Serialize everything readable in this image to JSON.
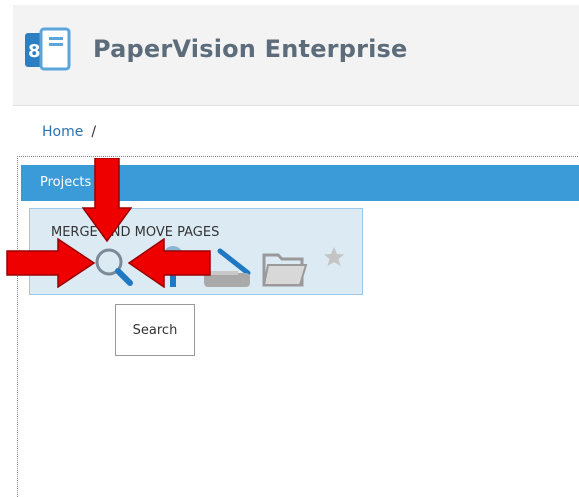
{
  "header": {
    "title": "PaperVision Enterprise",
    "logo_icon": "papervision-logo-icon"
  },
  "breadcrumb": {
    "home": "Home",
    "separator": "/"
  },
  "projects_panel": {
    "title": "Projects"
  },
  "project": {
    "name": "MERGE AND MOVE PAGES",
    "actions": [
      {
        "icon": "search-icon"
      },
      {
        "icon": "upload-icon"
      },
      {
        "icon": "scanner-icon"
      },
      {
        "icon": "folder-icon"
      },
      {
        "icon": "favorite-star-icon"
      }
    ]
  },
  "tooltip": {
    "text": "Search"
  },
  "colors": {
    "accent": "#3b9bd8",
    "card_bg": "#dceaf4",
    "arrow": "#ee0000"
  }
}
